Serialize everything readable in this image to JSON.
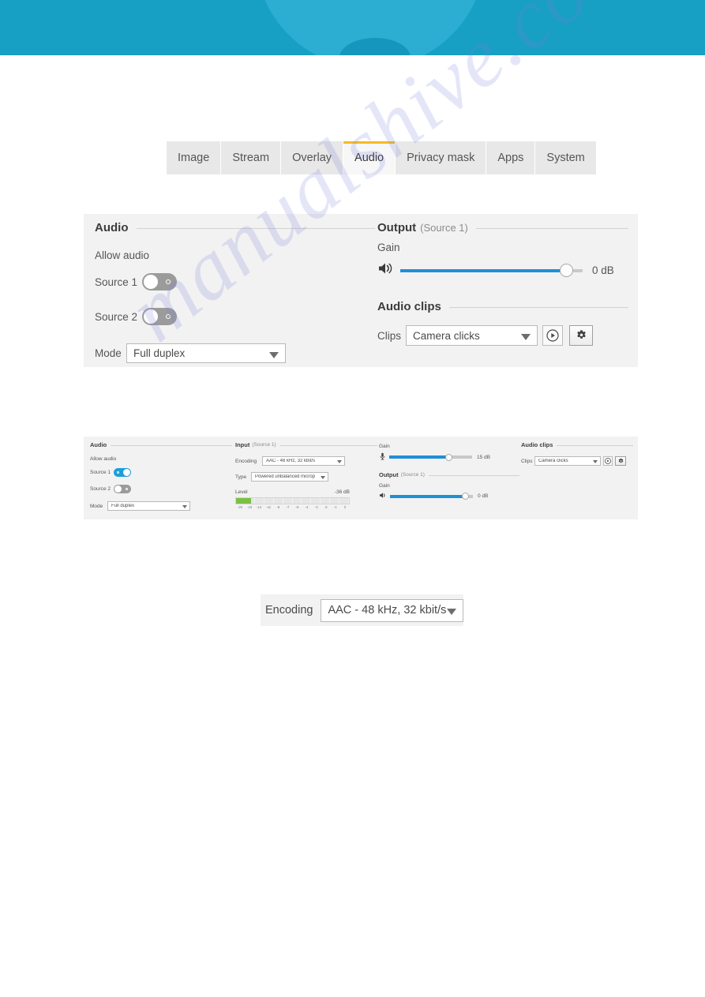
{
  "banner": {
    "color": "#179fc4",
    "arc_color": "#2cadd2"
  },
  "watermark": {
    "text": "manualshive.com"
  },
  "tabs": {
    "items": [
      {
        "label": "Image",
        "active": false
      },
      {
        "label": "Stream",
        "active": false
      },
      {
        "label": "Overlay",
        "active": false
      },
      {
        "label": "Audio",
        "active": true
      },
      {
        "label": "Privacy mask",
        "active": false
      },
      {
        "label": "Apps",
        "active": false
      },
      {
        "label": "System",
        "active": false
      }
    ],
    "active_indicator_color": "#f5b922"
  },
  "panel_main": {
    "audio": {
      "heading": "Audio",
      "allow_audio_label": "Allow audio",
      "source1_label": "Source 1",
      "source1_state": "off",
      "source2_label": "Source 2",
      "source2_state": "off",
      "mode_label": "Mode",
      "mode_value": "Full duplex"
    },
    "output": {
      "heading": "Output",
      "subheading": "(Source 1)",
      "gain_label": "Gain",
      "gain_value": "0 dB",
      "gain_percent": 91,
      "speaker_icon": "speaker-icon"
    },
    "audio_clips": {
      "heading": "Audio clips",
      "clips_label": "Clips",
      "clips_value": "Camera clicks",
      "play_icon": "play-circle-icon",
      "settings_icon": "gear-icon"
    }
  },
  "panel_small": {
    "audio": {
      "heading": "Audio",
      "allow_audio_label": "Allow audio",
      "source1_label": "Source 1",
      "source1_state": "on",
      "source2_label": "Source 2",
      "source2_state": "off",
      "mode_label": "Mode",
      "mode_value": "Full duplex"
    },
    "input": {
      "heading": "Input",
      "subheading": "(Source 1)",
      "encoding_label": "Encoding",
      "encoding_value": "AAC - 48 kHz, 32 kbit/s",
      "type_label": "Type",
      "type_value": "Powered unbalanced microp",
      "level_label": "Level",
      "level_value": "-36 dB",
      "level_fill_percent": 9,
      "scale": [
        "-20",
        "-18",
        "-14",
        "-11",
        "-9",
        "-7",
        "-6",
        "-4",
        "-3",
        "-2",
        "-1",
        "0"
      ],
      "meter_color": "#7ac143"
    },
    "gain_input": {
      "gain_label": "Gain",
      "gain_value": "15 dB",
      "gain_percent": 72,
      "mic_icon": "microphone-icon"
    },
    "output": {
      "heading": "Output",
      "subheading": "(Source 1)",
      "gain_label": "Gain",
      "gain_value": "0 dB",
      "gain_percent": 91,
      "speaker_icon": "speaker-icon"
    },
    "audio_clips": {
      "heading": "Audio clips",
      "clips_label": "Clips",
      "clips_value": "Camera clicks",
      "play_icon": "play-circle-icon",
      "settings_icon": "gear-icon"
    }
  },
  "encoding_detail": {
    "label": "Encoding",
    "value": "AAC - 48 kHz, 32 kbit/s"
  },
  "colors": {
    "accent_blue": "#1e90d8",
    "toggle_on": "#1b9fd8",
    "tab_active_bar": "#f5b922",
    "meter_green": "#7ac143"
  }
}
